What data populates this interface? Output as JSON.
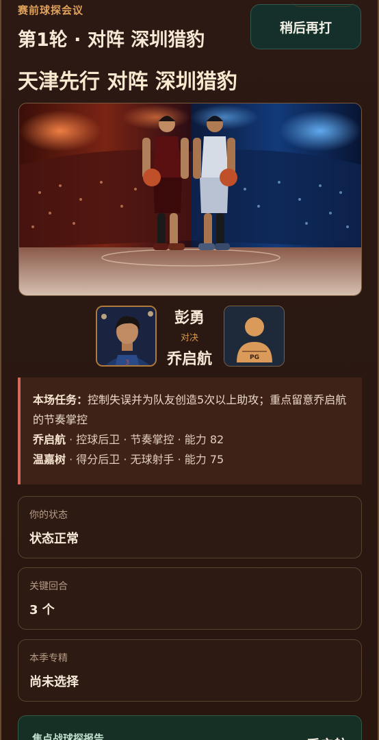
{
  "header": {
    "kicker": "赛前球探会议",
    "round_title": "第1轮 · 对阵 深圳猎豹",
    "later_button": "稍后再打",
    "matchup_title": "天津先行 对阵 深圳猎豹"
  },
  "versus": {
    "player_top": "彭勇",
    "vs_label": "对决",
    "player_bottom": "乔启航",
    "opponent_avatar_badge": "PG"
  },
  "mission": {
    "label": "本场任务：",
    "text": "控制失误并为队友创造5次以上助攻；重点留意乔启航的节奏掌控",
    "scouts": [
      {
        "name": "乔启航",
        "info": " · 控球后卫 · 节奏掌控 · 能力 82"
      },
      {
        "name": "温嘉树",
        "info": " · 得分后卫 · 无球射手 · 能力 75"
      }
    ]
  },
  "cards": [
    {
      "label": "你的状态",
      "value": "状态正常"
    },
    {
      "label": "关键回合",
      "value": "3 个"
    },
    {
      "label": "本季专精",
      "value": "尚未选择"
    }
  ],
  "report": {
    "title": "焦点战球探报告",
    "name": "乔启航"
  },
  "colors": {
    "background": "#2a1812",
    "accent": "#e0a25a",
    "mission_border": "#d46a5a",
    "button_bg": "#15302a"
  }
}
